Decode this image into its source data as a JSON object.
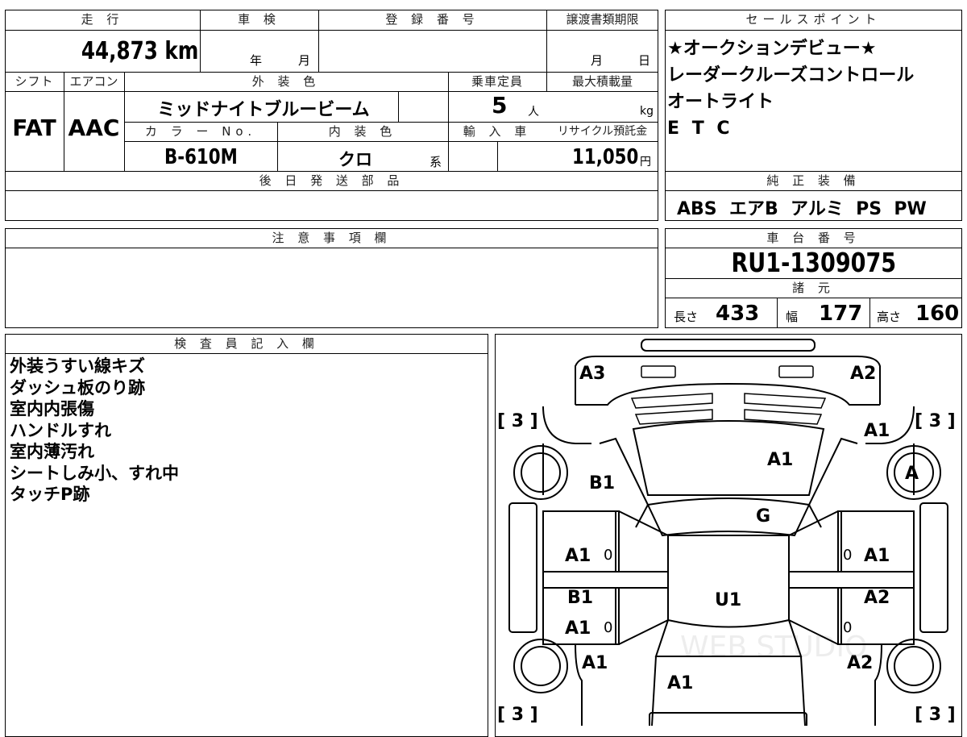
{
  "top": {
    "mileage_label": "走 行",
    "mileage_value": "44,873 km",
    "inspection_label": "車 検",
    "inspection_year": "年",
    "inspection_month": "月",
    "registration_label": "登 録 番 号",
    "registration_value": "",
    "transfer_label": "譲渡書類期限",
    "transfer_month": "月",
    "transfer_day": "日"
  },
  "row2": {
    "shift_label": "シフト",
    "shift_value": "FAT",
    "ac_label": "エアコン",
    "ac_value": "AAC",
    "exterior_label": "外 装 色",
    "exterior_value": "ミッドナイトブルービーム",
    "capacity_label": "乗車定員",
    "capacity_value": "5",
    "capacity_unit": "人",
    "max_load_label": "最大積載量",
    "max_load_unit": "kg",
    "color_no_label": "カ ラ ー No.",
    "color_no_value": "B-610M",
    "interior_label": "内 装 色",
    "interior_value": "クロ",
    "interior_suffix": "系",
    "import_label": "輸 入 車",
    "recycle_label": "リサイクル預託金",
    "recycle_value": "11,050",
    "recycle_unit": "円"
  },
  "later_parts_label": "後 日 発 送 部 品",
  "notes_label": "注 意 事 項 欄",
  "sales_points": {
    "label": "セールスポイント",
    "items": [
      "★オークションデビュー★",
      "レーダークルーズコントロール",
      "オートライト",
      "E T C"
    ]
  },
  "standard_equipment": {
    "label": "純 正 装 備",
    "value": "ABS  エアB  アルミ  PS  PW"
  },
  "chassis": {
    "label": "車 台 番 号",
    "value": "RU1-1309075"
  },
  "specs": {
    "label": "諸 元",
    "length_label": "長さ",
    "length_value": "433",
    "width_label": "幅",
    "width_value": "177",
    "height_label": "高さ",
    "height_value": "160"
  },
  "inspector": {
    "label": "検 査 員 記 入 欄",
    "items": [
      "外装うすい線キズ",
      "ダッシュ板のり跡",
      "室内内張傷",
      "ハンドルすれ",
      "室内薄汚れ",
      "シートしみ小、すれ中",
      "タッチP跡"
    ]
  },
  "diagram": {
    "tire_marks": [
      "[ 3 ]",
      "[ 3 ]",
      "[ 3 ]",
      "[ 3 ]"
    ],
    "small_zero": "0",
    "labels": {
      "rear_left": "A3",
      "rear_right": "A2",
      "roof": "A1",
      "right_rear_quarter": "A1",
      "right_rear_wheel": "A",
      "left_rear_quarter": "B1",
      "glass": "G",
      "left_rear_door": "A1",
      "right_rear_door": "A1",
      "left_front_door_upper": "B1",
      "left_front_door": "A1",
      "center": "U1",
      "right_front_door": "A2",
      "left_fender": "A1",
      "right_fender": "A2",
      "hood": "A1"
    },
    "watermark": "WEB STUDIO"
  }
}
